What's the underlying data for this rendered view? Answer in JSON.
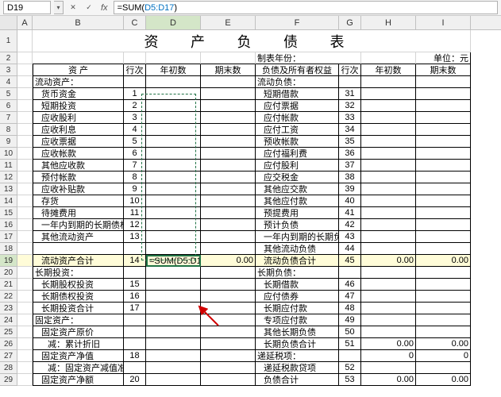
{
  "namebox": "D19",
  "formula_fn": "=SUM(",
  "formula_ref": "D5:D17",
  "formula_close": ")",
  "cols": [
    "A",
    "B",
    "C",
    "D",
    "E",
    "F",
    "G",
    "H",
    "I"
  ],
  "title": "资 产 负 债 表",
  "meta_left": "制表年份：",
  "meta_right": "单位：元",
  "h": {
    "asset": "资  产",
    "seq": "行次",
    "beg": "年初数",
    "end": "期末数",
    "liab": "负债及所有者权益"
  },
  "r": {
    "4": {
      "b": "流动资产：",
      "f": "流动负债："
    },
    "5": {
      "b": "货币资金",
      "c": "1",
      "f": "短期借款",
      "g": "31"
    },
    "6": {
      "b": "短期投资",
      "c": "2",
      "f": "应付票据",
      "g": "32"
    },
    "7": {
      "b": "应收股利",
      "c": "3",
      "f": "应付帐款",
      "g": "33"
    },
    "8": {
      "b": "应收利息",
      "c": "4",
      "f": "应付工资",
      "g": "34"
    },
    "9": {
      "b": "应收票据",
      "c": "5",
      "f": "预收帐款",
      "g": "35"
    },
    "10": {
      "b": "应收帐款",
      "c": "6",
      "f": "应付福利费",
      "g": "36"
    },
    "11": {
      "b": "其他应收款",
      "c": "7",
      "f": "应付股利",
      "g": "37"
    },
    "12": {
      "b": "预付帐款",
      "c": "8",
      "f": "应交税金",
      "g": "38"
    },
    "13": {
      "b": "应收补贴款",
      "c": "9",
      "f": "其他应交款",
      "g": "39"
    },
    "14": {
      "b": "存货",
      "c": "10",
      "f": "其他应付款",
      "g": "40"
    },
    "15": {
      "b": "待摊费用",
      "c": "11",
      "f": "预提费用",
      "g": "41"
    },
    "16": {
      "b": "一年内到期的长期债权投资",
      "c": "12",
      "f": "预计负债",
      "g": "42"
    },
    "17": {
      "b": "其他流动资产",
      "c": "13",
      "f": "一年内到期的长期负债",
      "g": "43"
    },
    "18": {
      "f": "其他流动负债",
      "g": "44"
    },
    "19": {
      "b": "流动资产合计",
      "c": "14",
      "e": "0.00",
      "f": "流动负债合计",
      "g": "45",
      "h": "0.00",
      "i": "0.00"
    },
    "20": {
      "b": "长期投资：",
      "f": "长期负债："
    },
    "21": {
      "b": "长期股权投资",
      "c": "15",
      "f": "长期借款",
      "g": "46"
    },
    "22": {
      "b": "长期债权投资",
      "c": "16",
      "f": "应付债券",
      "g": "47"
    },
    "23": {
      "b": "长期投资合计",
      "c": "17",
      "f": "长期应付款",
      "g": "48"
    },
    "24": {
      "b": "固定资产：",
      "f": "专项应付款",
      "g": "49"
    },
    "25": {
      "b": "固定资产原价",
      "f": "其他长期负债",
      "g": "50"
    },
    "26": {
      "b": "减：累计折旧",
      "f": "长期负债合计",
      "g": "51",
      "h": "0.00",
      "i": "0.00"
    },
    "27": {
      "b": "固定资产净值",
      "c": "18",
      "f": "递延税项：",
      "h": "0",
      "i": "0"
    },
    "28": {
      "b": "减：固定资产减值准备",
      "f": "递延税款贷项",
      "g": "52"
    },
    "29": {
      "b": "固定资产净额",
      "c": "20",
      "f": "负债合计",
      "g": "53",
      "h": "0.00",
      "i": "0.00"
    }
  },
  "formula_cell": "=SUM(D5:D17)",
  "chart_data": null
}
